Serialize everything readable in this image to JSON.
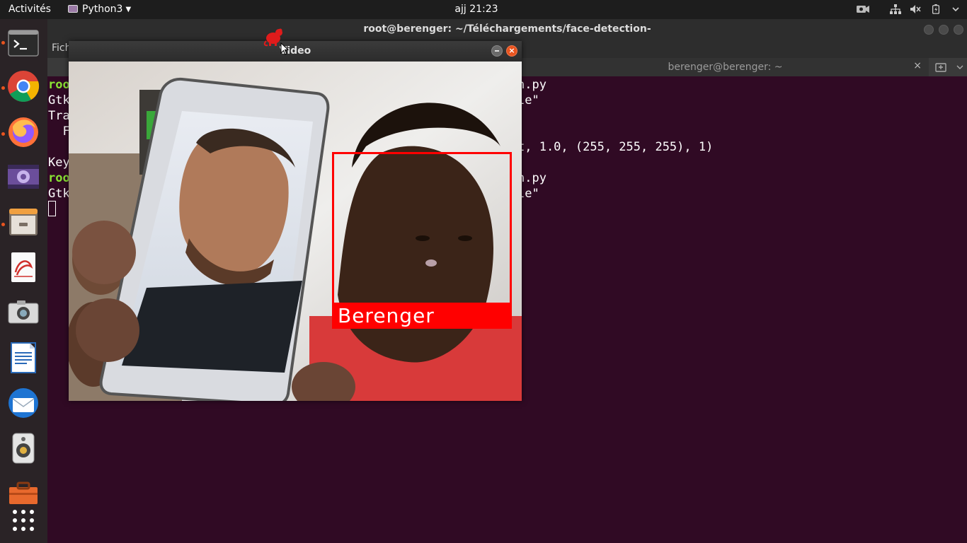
{
  "topbar": {
    "activities": "Activités",
    "app_menu": "Python3",
    "clock": "ajj 21:23"
  },
  "dock": {
    "items": [
      "terminal-icon",
      "chrome-icon",
      "firefox-icon",
      "video-player-icon",
      "files-icon",
      "document-viewer-icon",
      "screenshot-icon",
      "writer-icon",
      "thunderbird-icon",
      "sound-icon",
      "toolbox-icon",
      "app-grid-icon"
    ]
  },
  "terminal": {
    "title": "root@berenger: ~/Téléchargements/face-detection-",
    "menu_first": "Fich",
    "tab2_label": "berenger@berenger: ~",
    "tab2_close": "×",
    "lines": {
      "l1_prefix": "roo",
      "l1_suffix": "n.py",
      "l2_prefix": "Gtk",
      "l2_suffix": "le\"",
      "l3_prefix": "Tra",
      "l4_prefix": "  F",
      "l5_suffix": "t, 1.0, (255, 255, 255), 1)",
      "l6_prefix": "Key",
      "l7_prefix": "roo",
      "l7_suffix": "n.py",
      "l8_prefix": "Gtk",
      "l8_suffix": "le\""
    }
  },
  "video_window": {
    "title": "Video",
    "close_glyph": "×",
    "detection_label": "Berenger",
    "detection_color": "#ff0000"
  },
  "colors": {
    "terminal_bg": "#300a24",
    "prompt_green": "#8ae234",
    "accent_orange": "#e9541f"
  }
}
